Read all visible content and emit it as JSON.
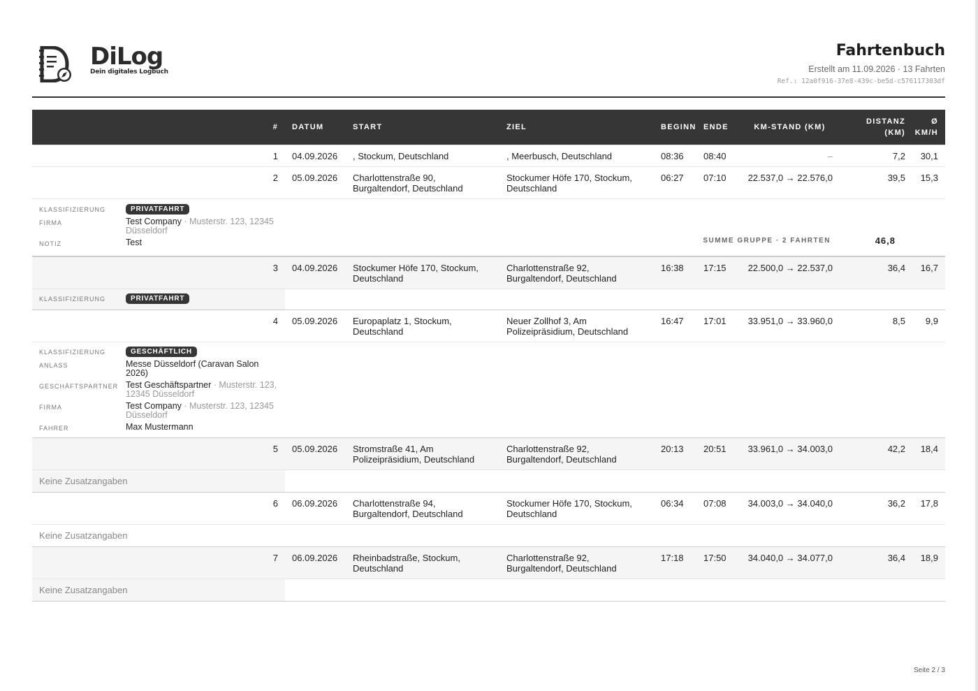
{
  "brand": {
    "name": "DiLog",
    "tagline": "Dein digitales Logbuch"
  },
  "doc": {
    "title": "Fahrtenbuch",
    "meta": "Erstellt am 11.09.2026 · 13 Fahrten",
    "ref": "Ref.: 12a0f916-37e8-439c-be5d-c576117303df"
  },
  "columns": {
    "nr": "#",
    "date": "Datum",
    "start": "Start",
    "dest": "Ziel",
    "begin": "Beginn",
    "end": "Ende",
    "odo": "KM-Stand (km)",
    "dist": "Distanz (km)",
    "speed": "Ø km/h"
  },
  "labels": {
    "klass": "Klassifizierung",
    "firma": "Firma",
    "notiz": "Notiz",
    "anlass": "Anlass",
    "partner": "Geschäftspartner",
    "fahrer": "Fahrer",
    "none": "Keine Zusatzangaben"
  },
  "trips": [
    {
      "nr": "1",
      "date": "04.09.2026",
      "start": ", Stockum, Deutschland",
      "dest": ", Meerbusch, Deutschland",
      "begin": "08:36",
      "end": "08:40",
      "odo": "–",
      "dist": "7,2",
      "speed": "30,1"
    },
    {
      "nr": "2",
      "date": "05.09.2026",
      "start": "Charlottenstraße 90, Burgaltendorf, Deutschland",
      "dest": "Stockumer Höfe 170, Stockum, Deutschland",
      "begin": "06:27",
      "end": "07:10",
      "odo": "22.537,0 → 22.576,0",
      "dist": "39,5",
      "speed": "15,3"
    },
    {
      "nr": "3",
      "date": "04.09.2026",
      "start": "Stockumer Höfe 170, Stockum, Deutschland",
      "dest": "Charlottenstraße 92, Burgaltendorf, Deutschland",
      "begin": "16:38",
      "end": "17:15",
      "odo": "22.500,0 → 22.537,0",
      "dist": "36,4",
      "speed": "16,7"
    },
    {
      "nr": "4",
      "date": "05.09.2026",
      "start": "Europaplatz 1, Stockum, Deutschland",
      "dest": "Neuer Zollhof 3, Am Polizeipräsidium, Deutschland",
      "begin": "16:47",
      "end": "17:01",
      "odo": "33.951,0 → 33.960,0",
      "dist": "8,5",
      "speed": "9,9"
    },
    {
      "nr": "5",
      "date": "05.09.2026",
      "start": "Stromstraße 41, Am Polizeipräsidium, Deutschland",
      "dest": "Charlottenstraße 92, Burgaltendorf, Deutschland",
      "begin": "20:13",
      "end": "20:51",
      "odo": "33.961,0 → 34.003,0",
      "dist": "42,2",
      "speed": "18,4"
    },
    {
      "nr": "6",
      "date": "06.09.2026",
      "start": "Charlottenstraße 94, Burgaltendorf, Deutschland",
      "dest": "Stockumer Höfe 170, Stockum, Deutschland",
      "begin": "06:34",
      "end": "07:08",
      "odo": "34.003,0 → 34.040,0",
      "dist": "36,2",
      "speed": "17,8"
    },
    {
      "nr": "7",
      "date": "06.09.2026",
      "start": "Rheinbadstraße, Stockum, Deutschland",
      "dest": "Charlottenstraße 92, Burgaltendorf, Deutschland",
      "begin": "17:18",
      "end": "17:50",
      "odo": "34.040,0 → 34.077,0",
      "dist": "36,4",
      "speed": "18,9"
    }
  ],
  "group1": {
    "klass": "Privatfahrt",
    "firma_name": "Test Company",
    "firma_addr": "· Musterstr. 123, 12345 Düsseldorf",
    "notiz": "Test",
    "sum_label": "Summe Gruppe · 2 Fahrten",
    "sum_value": "46,8"
  },
  "trip3": {
    "klass": "Privatfahrt"
  },
  "trip4": {
    "klass": "Geschäftlich",
    "anlass": "Messe Düsseldorf (Caravan Salon 2026)",
    "partner_name": "Test Geschäftspartner",
    "partner_addr": "· Musterstr. 123, 12345 Düsseldorf",
    "firma_name": "Test Company",
    "firma_addr": "· Musterstr. 123, 12345 Düsseldorf",
    "fahrer": "Max Mustermann"
  },
  "footer": {
    "page": "Seite 2 / 3"
  }
}
